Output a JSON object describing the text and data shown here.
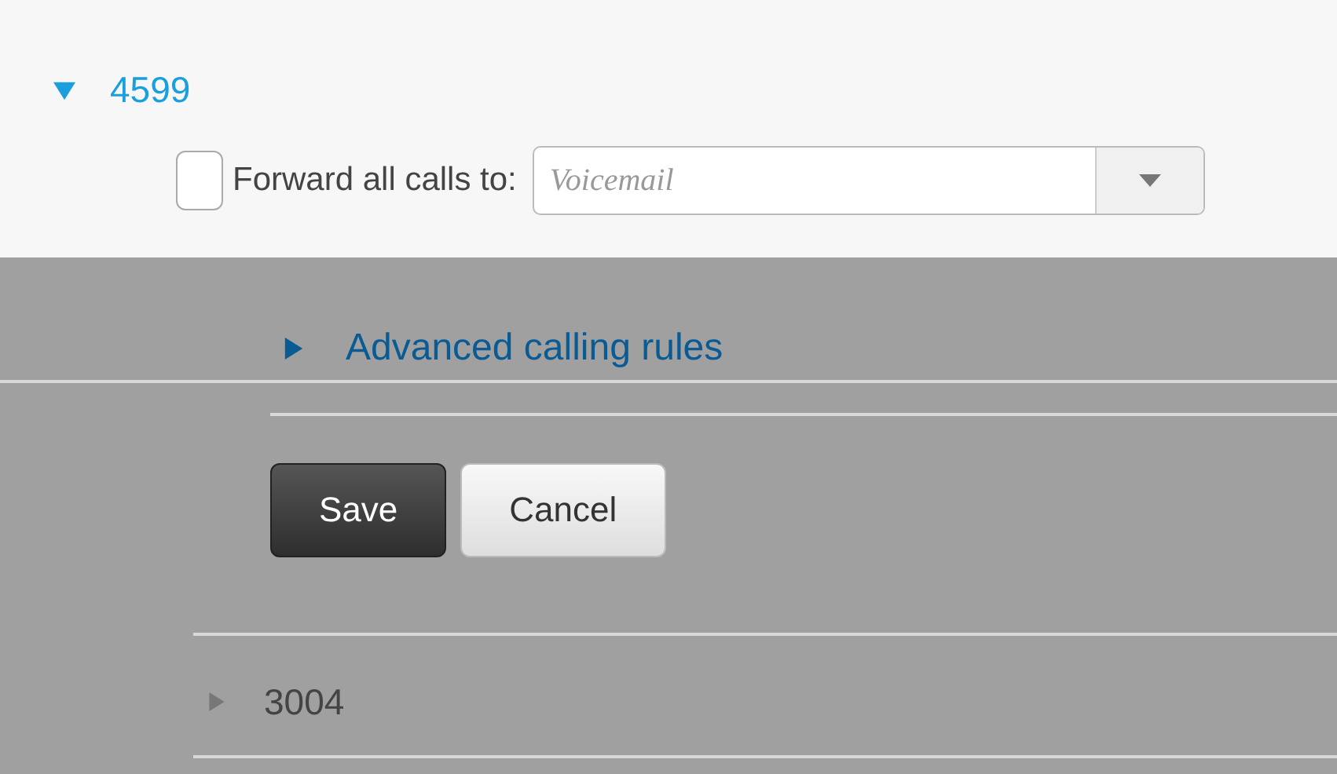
{
  "extension": {
    "number": "4599",
    "expanded": true
  },
  "forward": {
    "label": "Forward all calls to:",
    "checked": false,
    "placeholder": "Voicemail"
  },
  "advanced": {
    "label": "Advanced calling rules",
    "expanded": false
  },
  "buttons": [
    {
      "label": "Save",
      "kind": "primary"
    },
    {
      "label": "Cancel",
      "kind": "secondary"
    }
  ],
  "other_extensions": [
    {
      "number": "3004",
      "expanded": false
    }
  ]
}
